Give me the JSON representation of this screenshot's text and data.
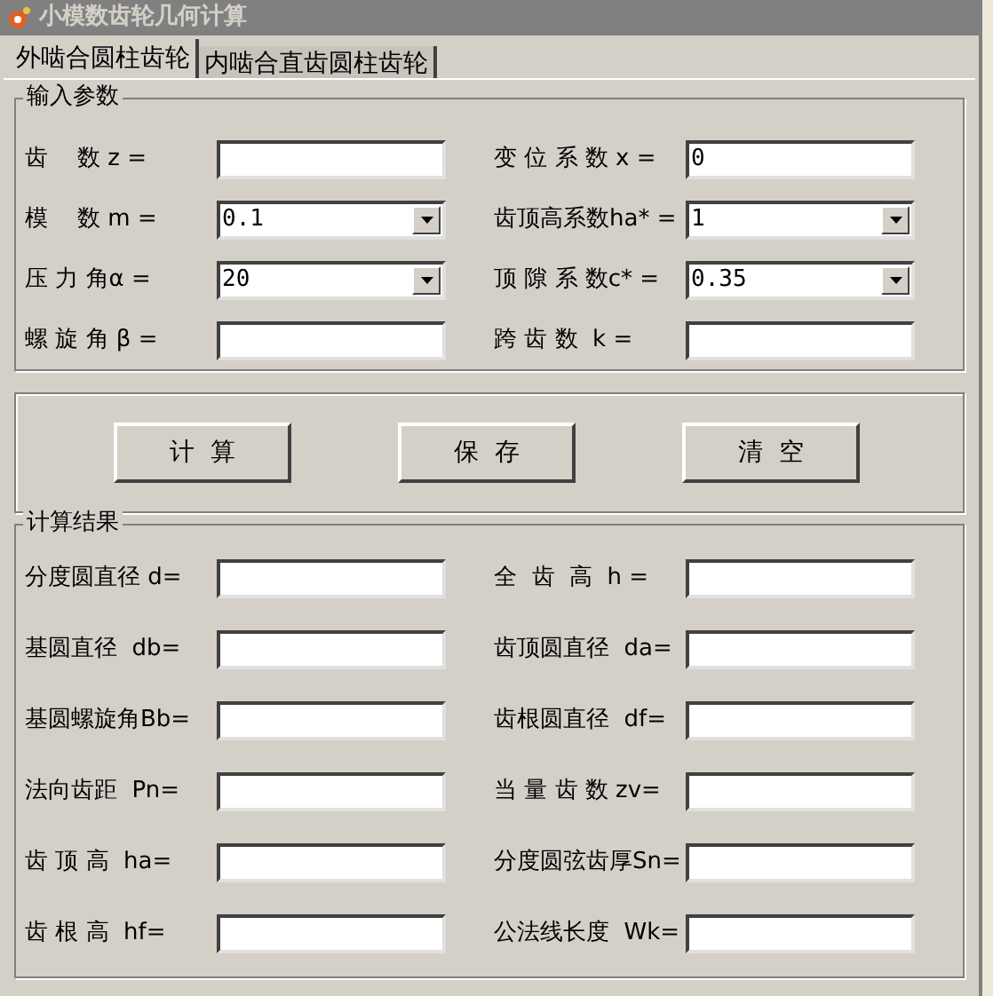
{
  "window": {
    "title": "小模数齿轮几何计算"
  },
  "tabs": [
    {
      "label": "外啮合圆柱齿轮",
      "selected": true
    },
    {
      "label": "内啮合直齿圆柱齿轮",
      "selected": false
    }
  ],
  "input_group": {
    "title": "输入参数",
    "fields": [
      {
        "label": "齿    数 z =",
        "kind": "text"
      },
      {
        "label": "变 位 系 数 x =",
        "kind": "text",
        "value": "0"
      },
      {
        "label": "模    数 m =",
        "kind": "select",
        "value": "0.1"
      },
      {
        "label": "齿顶高系数ha* =",
        "kind": "select",
        "value": "1"
      },
      {
        "label": "压 力 角α =",
        "kind": "select",
        "value": "20"
      },
      {
        "label": "顶 隙 系 数c* =",
        "kind": "select",
        "value": "0.35"
      },
      {
        "label": "螺 旋 角 β =",
        "kind": "text"
      },
      {
        "label": "跨 齿 数  k =",
        "kind": "text"
      }
    ]
  },
  "buttons": [
    "计  算",
    "保  存",
    "清  空"
  ],
  "result_group": {
    "title": "计算结果",
    "fields": [
      {
        "label": "分度圆直径 d="
      },
      {
        "label": "全  齿  高  h ="
      },
      {
        "label": "基圆直径  db="
      },
      {
        "label": "齿顶圆直径  da="
      },
      {
        "label": "基圆螺旋角Bb="
      },
      {
        "label": "齿根圆直径  df="
      },
      {
        "label": "法向齿距  Pn="
      },
      {
        "label": "当 量 齿 数 zv="
      },
      {
        "label": "齿 顶 高  ha="
      },
      {
        "label": "分度圆弦齿厚Sn="
      },
      {
        "label": "齿 根 高  hf="
      },
      {
        "label": "公法线长度  Wk="
      }
    ]
  }
}
